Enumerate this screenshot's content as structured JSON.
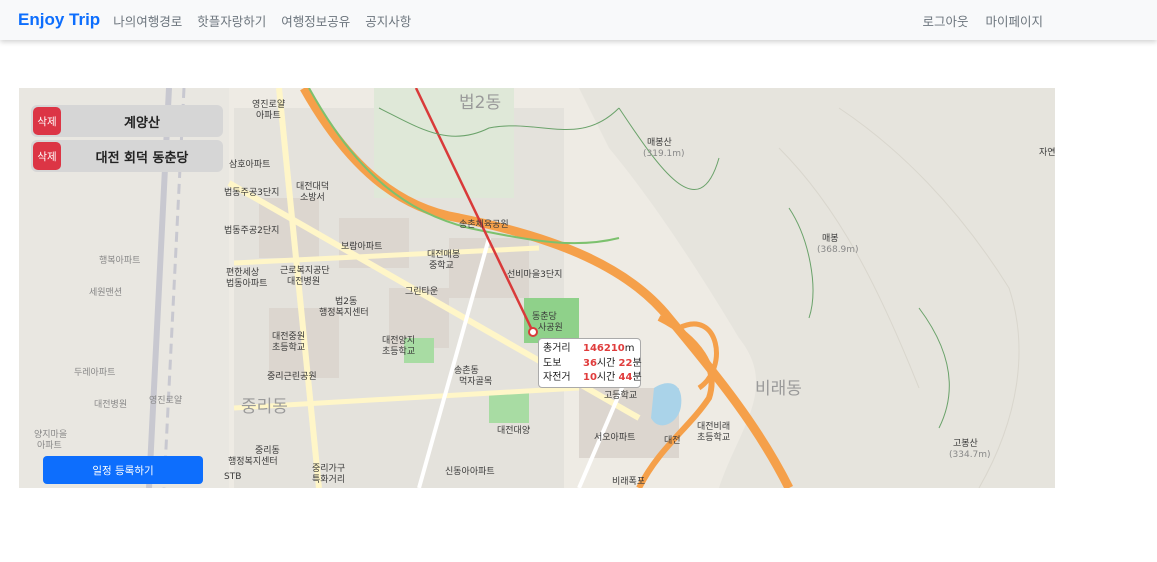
{
  "navbar": {
    "brand": "Enjoy Trip",
    "links": [
      "나의여행경로",
      "핫플자랑하기",
      "여행정보공유",
      "공지사항"
    ],
    "right_links": [
      "로그아웃",
      "마이페이지"
    ]
  },
  "schedule": {
    "delete_label": "삭제",
    "items": [
      "계양산",
      "대전 회덕 동춘당"
    ]
  },
  "register_button": "일정 등록하기",
  "route_info": {
    "distance_label": "총거리",
    "distance_value": "146210",
    "distance_unit": "m",
    "walk_label": "도보",
    "walk_hours": "36",
    "walk_minutes": "22",
    "bike_label": "자전거",
    "bike_hours": "10",
    "bike_minutes": "44",
    "hour_unit": "시간",
    "minute_unit": "분"
  },
  "map_labels": [
    "법2동",
    "매봉산",
    "(319.1m)",
    "매봉",
    "(368.9m)",
    "비래동",
    "고봉산",
    "(334.7m)",
    "영진로얄",
    "아파트",
    "삼호아파트",
    "법동주공3단지",
    "대전대덕",
    "소방서",
    "법동주공2단지",
    "보람아파트",
    "대전매봉",
    "중학교",
    "편한세상",
    "법동아파트",
    "근로복지공단",
    "대전병원",
    "법2동",
    "행정복지센터",
    "그린타운",
    "대전중원",
    "초등학교",
    "대전양지",
    "초등학교",
    "중리근린공원",
    "중리동",
    "송촌동",
    "먹자골목",
    "대전대양",
    "중리동",
    "행정복지센터",
    "중리가구",
    "특화거리",
    "신동아아파트",
    "서오아파트",
    "대전비래",
    "초등학교",
    "비래폭포",
    "동춘당",
    "사공원",
    "대전",
    "고등학교",
    "대전",
    "STB",
    "행복아파트",
    "세원맨션",
    "두레아파트",
    "대전병원",
    "영진로얄",
    "양지마을",
    "아파트",
    "송촌체육공원",
    "선비마을3단지",
    "자연"
  ],
  "colors": {
    "brand": "#0d6efd",
    "delete": "#dc3545",
    "route_line": "#d93a3a",
    "highway": "#f5a04a",
    "park": "#8fd18a"
  }
}
